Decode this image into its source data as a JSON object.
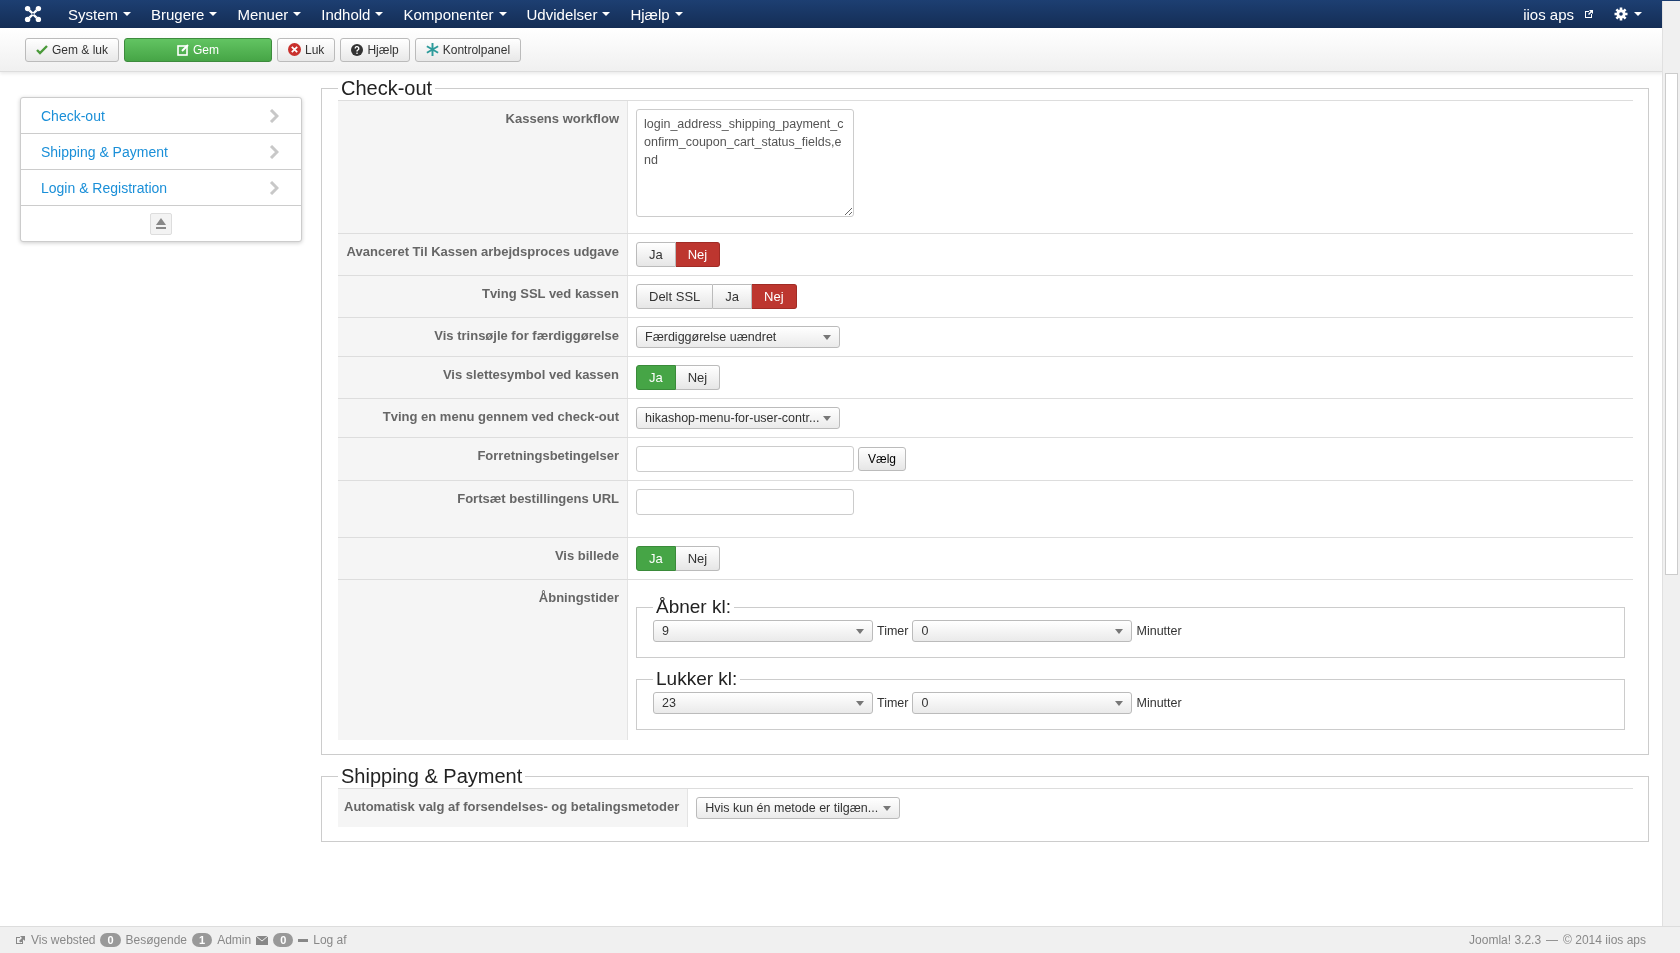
{
  "navbar": {
    "menus": [
      "System",
      "Brugere",
      "Menuer",
      "Indhold",
      "Komponenter",
      "Udvidelser",
      "Hjælp"
    ],
    "site": "iios aps"
  },
  "toolbar": [
    {
      "label": "Gem & luk",
      "kind": "save-close"
    },
    {
      "label": "Gem",
      "kind": "save"
    },
    {
      "label": "Luk",
      "kind": "close"
    },
    {
      "label": "Hjælp",
      "kind": "help"
    },
    {
      "label": "Kontrolpanel",
      "kind": "dashboard"
    }
  ],
  "sidebar": {
    "items": [
      {
        "label": "Check-out"
      },
      {
        "label": "Shipping & Payment"
      },
      {
        "label": "Login & Registration"
      }
    ]
  },
  "sections": [
    {
      "legend": "Check-out",
      "rows": [
        {
          "kind": "textarea",
          "label": "Kassens workflow",
          "value": "login_address_shipping_payment_confirm_coupon_cart_status_fields,end"
        },
        {
          "kind": "toggle",
          "label": "Avanceret Til Kassen arbejdsproces udgave",
          "options": [
            {
              "label": "Ja",
              "kind": "yes",
              "selected": false
            },
            {
              "label": "Nej",
              "kind": "no",
              "selected": true
            }
          ]
        },
        {
          "kind": "toggle",
          "label": "Tving SSL ved kassen",
          "options": [
            {
              "label": "Delt SSL",
              "kind": "neutral",
              "selected": false
            },
            {
              "label": "Ja",
              "kind": "yes",
              "selected": false
            },
            {
              "label": "Nej",
              "kind": "no",
              "selected": true
            }
          ]
        },
        {
          "kind": "select",
          "label": "Vis trinsøjle for færdiggørelse",
          "value": "Færdiggørelse uændret"
        },
        {
          "kind": "toggle",
          "label": "Vis slettesymbol ved kassen",
          "options": [
            {
              "label": "Ja",
              "kind": "yes",
              "selected": true
            },
            {
              "label": "Nej",
              "kind": "no",
              "selected": false
            }
          ]
        },
        {
          "kind": "select",
          "label": "Tving en menu gennem ved check-out",
          "value": "hikashop-menu-for-user-contr..."
        },
        {
          "kind": "picker",
          "label": "Forretningsbetingelser",
          "button": "Vælg"
        },
        {
          "kind": "text",
          "label": "Fortsæt bestillingens URL"
        },
        {
          "kind": "toggle",
          "label": "Vis billede",
          "options": [
            {
              "label": "Ja",
              "kind": "yes",
              "selected": true
            },
            {
              "label": "Nej",
              "kind": "no",
              "selected": false
            }
          ]
        },
        {
          "kind": "hours",
          "label": "Åbningstider",
          "groups": [
            {
              "legend": "Åbner kl:",
              "hour": "9",
              "hour_unit": "Timer",
              "minute": "0",
              "minute_unit": "Minutter"
            },
            {
              "legend": "Lukker kl:",
              "hour": "23",
              "hour_unit": "Timer",
              "minute": "0",
              "minute_unit": "Minutter"
            }
          ]
        }
      ]
    },
    {
      "legend": "Shipping & Payment",
      "rows": [
        {
          "kind": "select",
          "label": "Automatisk valg af forsendelses- og betalingsmetoder",
          "value": "Hvis kun én metode er tilgæn..."
        }
      ]
    }
  ],
  "status_bar": {
    "view_site": "Vis websted",
    "visitors_count": "0",
    "visitors": "Besøgende",
    "admins_count": "1",
    "admins": "Admin",
    "messages_count": "0",
    "logout": "Log af",
    "version": "Joomla! 3.2.3",
    "copyright": "© 2014 iios aps",
    "separator": "—"
  }
}
